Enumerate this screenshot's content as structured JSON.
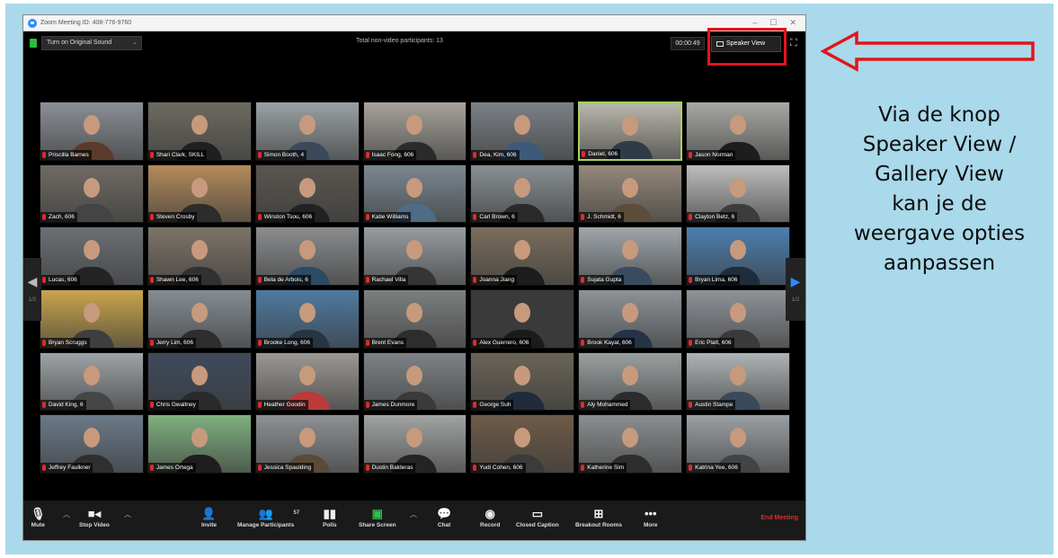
{
  "window": {
    "title": "Zoom Meeting ID: 408-776-9760",
    "controls": [
      "–",
      "☐",
      "✕"
    ]
  },
  "topbar": {
    "sound_button": "Turn on Original Sound",
    "participants_text": "Total non-video participants: 13",
    "timer": "00:00:49",
    "speaker_view": "Speaker View"
  },
  "gallery": {
    "tiles": [
      {
        "name": "Priscilla Barnes",
        "bg": "#8a8f96",
        "shirt": "#5b3a2c"
      },
      {
        "name": "Shari Clark, SKILL",
        "bg": "#6d6a60",
        "shirt": "#1f1f1f"
      },
      {
        "name": "Simon Booth, 4",
        "bg": "#9aa1a4",
        "shirt": "#3b4a5a"
      },
      {
        "name": "Isaac Fong, 606",
        "bg": "#a7a39b",
        "shirt": "#2b2b2b"
      },
      {
        "name": "Dea, Kim, 606",
        "bg": "#7b8187",
        "shirt": "#3d5a7a"
      },
      {
        "name": "Daniel, 606",
        "bg": "#b9b7ad",
        "shirt": "#2f3b46",
        "active": true
      },
      {
        "name": "Jason Norman",
        "bg": "#a8a8a4",
        "shirt": "#1d1d1d"
      },
      {
        "name": "Zach, 606",
        "bg": "#6f6a63",
        "shirt": "#444"
      },
      {
        "name": "Steven Crosby",
        "bg": "#b48a5a",
        "shirt": "#2c2c2c"
      },
      {
        "name": "Winston Tsou, 606",
        "bg": "#5a5650",
        "shirt": "#222"
      },
      {
        "name": "Katie Williams",
        "bg": "#7a8891",
        "shirt": "#4d6c86"
      },
      {
        "name": "Carl Brown, 6",
        "bg": "#888f93",
        "shirt": "#2a2a2a"
      },
      {
        "name": "J. Schmidt, 6",
        "bg": "#94887a",
        "shirt": "#5c4c3a"
      },
      {
        "name": "Clayton Betz, 6",
        "bg": "#bdbdbd",
        "shirt": "#3c3c3c"
      },
      {
        "name": "Lucas, 606",
        "bg": "#6b7075",
        "shirt": "#242424"
      },
      {
        "name": "Shawn Lee, 606",
        "bg": "#7d7467",
        "shirt": "#313131"
      },
      {
        "name": "Bela de Arbois, 6",
        "bg": "#8a8c8e",
        "shirt": "#2d4a64"
      },
      {
        "name": "Rachael Villa",
        "bg": "#969ca0",
        "shirt": "#353535"
      },
      {
        "name": "Joanna Jiang",
        "bg": "#7b6d5c",
        "shirt": "#1c1c1c"
      },
      {
        "name": "Sujata Gupta",
        "bg": "#9fa6ab",
        "shirt": "#394b5e"
      },
      {
        "name": "Bryan Lima, 606",
        "bg": "#4b7fb0",
        "shirt": "#1f2c3c"
      },
      {
        "name": "Bryan Scruggs",
        "bg": "#c9a54b",
        "shirt": "#3e3e3e"
      },
      {
        "name": "Jerry Lim, 606",
        "bg": "#858d93",
        "shirt": "#2e2e2e"
      },
      {
        "name": "Brooke Long, 606",
        "bg": "#4e7aa1",
        "shirt": "#273442"
      },
      {
        "name": "Brent Evans",
        "bg": "#7c7f80",
        "shirt": "#2d2d2d"
      },
      {
        "name": "Alex Guerrero, 606",
        "bg": "#3a3a3a",
        "shirt": "#1b1b1b"
      },
      {
        "name": "Brook Kayal, 606",
        "bg": "#8d9398",
        "shirt": "#243346"
      },
      {
        "name": "Eric Platt, 606",
        "bg": "#8f9499",
        "shirt": "#3a3a3a"
      },
      {
        "name": "David King, 6",
        "bg": "#9da3a6",
        "shirt": "#464646"
      },
      {
        "name": "Chris Gwaltney",
        "bg": "#3f4a5c",
        "shirt": "#2a2a2a"
      },
      {
        "name": "Heather Goodin",
        "bg": "#9b9893",
        "shirt": "#b93b3b"
      },
      {
        "name": "James Dunmore",
        "bg": "#7e8285",
        "shirt": "#3a3a3a"
      },
      {
        "name": "George Suh",
        "bg": "#6a6457",
        "shirt": "#1f2b38"
      },
      {
        "name": "Aly Mohammed",
        "bg": "#9aa0a0",
        "shirt": "#2c2c2c"
      },
      {
        "name": "Austin Stampe",
        "bg": "#aeb3b5",
        "shirt": "#3a4a5a"
      },
      {
        "name": "Jeffrey Faulkner",
        "bg": "#6b7a88",
        "shirt": "#2f2f2f"
      },
      {
        "name": "James Ortega",
        "bg": "#7fb07f",
        "shirt": "#1e1e1e"
      },
      {
        "name": "Jessica Spaulding",
        "bg": "#8e9194",
        "shirt": "#5a4a3a"
      },
      {
        "name": "Dustin Balderas",
        "bg": "#a2a4a4",
        "shirt": "#242424"
      },
      {
        "name": "Yudi Cohen, 606",
        "bg": "#6e5b47",
        "shirt": "#3b3b3b"
      },
      {
        "name": "Katherine Sim",
        "bg": "#8b8f91",
        "shirt": "#2d2d2d"
      },
      {
        "name": "Katrina Yee, 606",
        "bg": "#9ba0a4",
        "shirt": "#434343"
      }
    ]
  },
  "nav": {
    "left_arrow": "◀",
    "left_page": "1/2",
    "right_arrow": "▶",
    "right_page": "1/2"
  },
  "toolbar": {
    "mute": "Mute",
    "stop_video": "Stop Video",
    "invite": "Invite",
    "manage_participants": "Manage Participants",
    "participant_count": "57",
    "polls": "Polls",
    "share_screen": "Share Screen",
    "chat": "Chat",
    "record": "Record",
    "closed_caption": "Closed Caption",
    "breakout_rooms": "Breakout Rooms",
    "more": "More",
    "end_meeting": "End Meeting"
  },
  "annotation": {
    "lines": [
      "Via de knop",
      "Speaker View /",
      "Gallery View",
      "kan je de",
      "weergave opties",
      "aanpassen"
    ],
    "arrow_color": "#e3141b"
  }
}
